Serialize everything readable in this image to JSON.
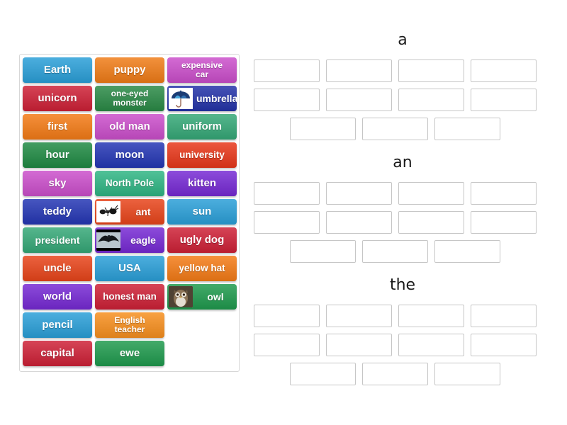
{
  "activity": {
    "type": "drag-and-drop-group-sort",
    "background": "#ffffff"
  },
  "tile_pool": {
    "name": "word-tile-pool",
    "columns": 3,
    "tiles": [
      {
        "label": "Earth",
        "color": "#2a9fd8",
        "icon": null
      },
      {
        "label": "puppy",
        "color": "#f07c17",
        "icon": null
      },
      {
        "label": "expensive\ncar",
        "color": "#cb4ecb",
        "icon": null
      },
      {
        "label": "unicorn",
        "color": "#ce2036",
        "icon": null
      },
      {
        "label": "one-eyed\nmonster",
        "color": "#2a8a46",
        "icon": null
      },
      {
        "label": "umbrella",
        "color": "#2332a8",
        "icon": "umbrella-photo"
      },
      {
        "label": "first",
        "color": "#f47b16",
        "icon": null
      },
      {
        "label": "old man",
        "color": "#cb4ecb",
        "icon": null
      },
      {
        "label": "uniform",
        "color": "#35a877",
        "icon": null
      },
      {
        "label": "hour",
        "color": "#1f8a43",
        "icon": null
      },
      {
        "label": "moon",
        "color": "#2436b4",
        "icon": null
      },
      {
        "label": "university",
        "color": "#e8371a",
        "icon": null
      },
      {
        "label": "sky",
        "color": "#cb4ecb",
        "icon": null
      },
      {
        "label": "North Pole",
        "color": "#2eb583",
        "icon": null
      },
      {
        "label": "kitten",
        "color": "#7629d4",
        "icon": null
      },
      {
        "label": "teddy",
        "color": "#2436b4",
        "icon": null
      },
      {
        "label": "ant",
        "color": "#e8441a",
        "icon": "ant-photo"
      },
      {
        "label": "sun",
        "color": "#2a9fd8",
        "icon": null
      },
      {
        "label": "president",
        "color": "#35a877",
        "icon": null
      },
      {
        "label": "eagle",
        "color": "#7629d4",
        "icon": "eagle-photo"
      },
      {
        "label": "ugly dog",
        "color": "#ce2036",
        "icon": null
      },
      {
        "label": "uncle",
        "color": "#e8441a",
        "icon": null
      },
      {
        "label": "USA",
        "color": "#2a9fd8",
        "icon": null
      },
      {
        "label": "yellow hat",
        "color": "#f47b16",
        "icon": null
      },
      {
        "label": "world",
        "color": "#7629d4",
        "icon": null
      },
      {
        "label": "honest man",
        "color": "#ce2036",
        "icon": null
      },
      {
        "label": "owl",
        "color": "#1f9a4d",
        "icon": "owl-photo"
      },
      {
        "label": "pencil",
        "color": "#2a9fd8",
        "icon": null
      },
      {
        "label": "English\nteacher",
        "color": "#f78f1e",
        "icon": null
      },
      {
        "label": "",
        "color": null,
        "icon": null
      },
      {
        "label": "capital",
        "color": "#ce2036",
        "icon": null
      },
      {
        "label": "ewe",
        "color": "#1f9a4d",
        "icon": null
      },
      {
        "label": "",
        "color": null,
        "icon": null
      }
    ]
  },
  "groups": [
    {
      "title": "a",
      "slot_rows": [
        4,
        4,
        3
      ]
    },
    {
      "title": "an",
      "slot_rows": [
        4,
        4,
        3
      ]
    },
    {
      "title": "the",
      "slot_rows": [
        4,
        4,
        3
      ]
    }
  ]
}
